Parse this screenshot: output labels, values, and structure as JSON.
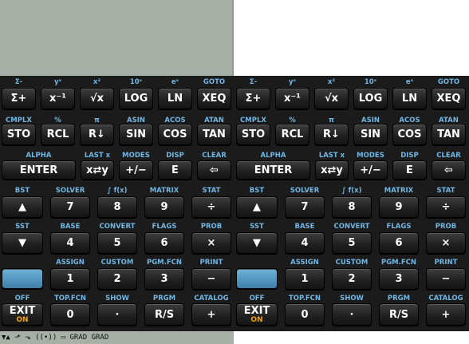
{
  "status_bar": {
    "text": "▼▲ ⬏ ⬎ ((•)) ▭ GRAD GRAD"
  },
  "pads": [
    {
      "rows": [
        {
          "keys": [
            {
              "label": "Σ+",
              "shift": "Σ-"
            },
            {
              "label": "x⁻¹",
              "shift": "yˣ"
            },
            {
              "label": "√x",
              "shift": "x²"
            },
            {
              "label": "LOG",
              "shift": "10ˣ"
            },
            {
              "label": "LN",
              "shift": "eˣ"
            },
            {
              "label": "XEQ",
              "shift": "GOTO"
            }
          ]
        },
        {
          "keys": [
            {
              "label": "STO",
              "shift": "CMPLX"
            },
            {
              "label": "RCL",
              "shift": "%"
            },
            {
              "label": "R↓",
              "shift": "π"
            },
            {
              "label": "SIN",
              "shift": "ASIN"
            },
            {
              "label": "COS",
              "shift": "ACOS"
            },
            {
              "label": "TAN",
              "shift": "ATAN"
            }
          ]
        },
        {
          "keys": [
            {
              "label": "ENTER",
              "shift": "ALPHA"
            },
            {
              "label": "x⇄y",
              "shift": "LAST x"
            },
            {
              "label": "+/−",
              "shift": "MODES"
            },
            {
              "label": "E",
              "shift": "DISP"
            },
            {
              "label": "⇦",
              "shift": "CLEAR"
            }
          ]
        },
        {
          "keys": [
            {
              "label": "▲",
              "shift": "BST"
            },
            {
              "label": "7",
              "shift": "SOLVER"
            },
            {
              "label": "8",
              "shift": "∫ f(x)"
            },
            {
              "label": "9",
              "shift": "MATRIX"
            },
            {
              "label": "÷",
              "shift": "STAT"
            }
          ]
        },
        {
          "keys": [
            {
              "label": "▼",
              "shift": "SST"
            },
            {
              "label": "4",
              "shift": "BASE"
            },
            {
              "label": "5",
              "shift": "CONVERT"
            },
            {
              "label": "6",
              "shift": "FLAGS"
            },
            {
              "label": "×",
              "shift": "PROB"
            }
          ]
        },
        {
          "keys": [
            {
              "label": "",
              "shift": ""
            },
            {
              "label": "1",
              "shift": "ASSIGN"
            },
            {
              "label": "2",
              "shift": "CUSTOM"
            },
            {
              "label": "3",
              "shift": "PGM.FCN"
            },
            {
              "label": "−",
              "shift": "PRINT"
            }
          ]
        },
        {
          "keys": [
            {
              "label": "EXIT",
              "shift": "OFF",
              "sub": "ON"
            },
            {
              "label": "0",
              "shift": "TOP.FCN"
            },
            {
              "label": "·",
              "shift": "SHOW"
            },
            {
              "label": "R/S",
              "shift": "PRGM"
            },
            {
              "label": "+",
              "shift": "CATALOG"
            }
          ]
        }
      ]
    },
    {
      "rows": [
        {
          "keys": [
            {
              "label": "Σ+",
              "shift": "Σ-"
            },
            {
              "label": "x⁻¹",
              "shift": "yˣ"
            },
            {
              "label": "√x",
              "shift": "x²"
            },
            {
              "label": "LOG",
              "shift": "10ˣ"
            },
            {
              "label": "LN",
              "shift": "eˣ"
            },
            {
              "label": "XEQ",
              "shift": "GOTO"
            }
          ]
        },
        {
          "keys": [
            {
              "label": "STO",
              "shift": "CMPLX"
            },
            {
              "label": "RCL",
              "shift": "%"
            },
            {
              "label": "R↓",
              "shift": "π"
            },
            {
              "label": "SIN",
              "shift": "ASIN"
            },
            {
              "label": "COS",
              "shift": "ACOS"
            },
            {
              "label": "TAN",
              "shift": "ATAN"
            }
          ]
        },
        {
          "keys": [
            {
              "label": "ENTER",
              "shift": "ALPHA"
            },
            {
              "label": "x⇄y",
              "shift": "LAST x"
            },
            {
              "label": "+/−",
              "shift": "MODES"
            },
            {
              "label": "E",
              "shift": "DISP"
            },
            {
              "label": "⇦",
              "shift": "CLEAR"
            }
          ]
        },
        {
          "keys": [
            {
              "label": "▲",
              "shift": "BST"
            },
            {
              "label": "7",
              "shift": "SOLVER"
            },
            {
              "label": "8",
              "shift": "∫ f(x)"
            },
            {
              "label": "9",
              "shift": "MATRIX"
            },
            {
              "label": "÷",
              "shift": "STAT"
            }
          ]
        },
        {
          "keys": [
            {
              "label": "▼",
              "shift": "SST"
            },
            {
              "label": "4",
              "shift": "BASE"
            },
            {
              "label": "5",
              "shift": "CONVERT"
            },
            {
              "label": "6",
              "shift": "FLAGS"
            },
            {
              "label": "×",
              "shift": "PROB"
            }
          ]
        },
        {
          "keys": [
            {
              "label": "",
              "shift": ""
            },
            {
              "label": "1",
              "shift": "ASSIGN"
            },
            {
              "label": "2",
              "shift": "CUSTOM"
            },
            {
              "label": "3",
              "shift": "PGM.FCN"
            },
            {
              "label": "−",
              "shift": "PRINT"
            }
          ]
        },
        {
          "keys": [
            {
              "label": "EXIT",
              "shift": "OFF",
              "sub": "ON"
            },
            {
              "label": "0",
              "shift": "TOP.FCN"
            },
            {
              "label": "·",
              "shift": "SHOW"
            },
            {
              "label": "R/S",
              "shift": "PRGM"
            },
            {
              "label": "+",
              "shift": "CATALOG"
            }
          ]
        }
      ]
    }
  ],
  "colors": {
    "shift_label": "#72b6e3",
    "shift_key": "#4f94c0",
    "on_label": "#f5a200",
    "lcd": "#a7b0a6"
  }
}
